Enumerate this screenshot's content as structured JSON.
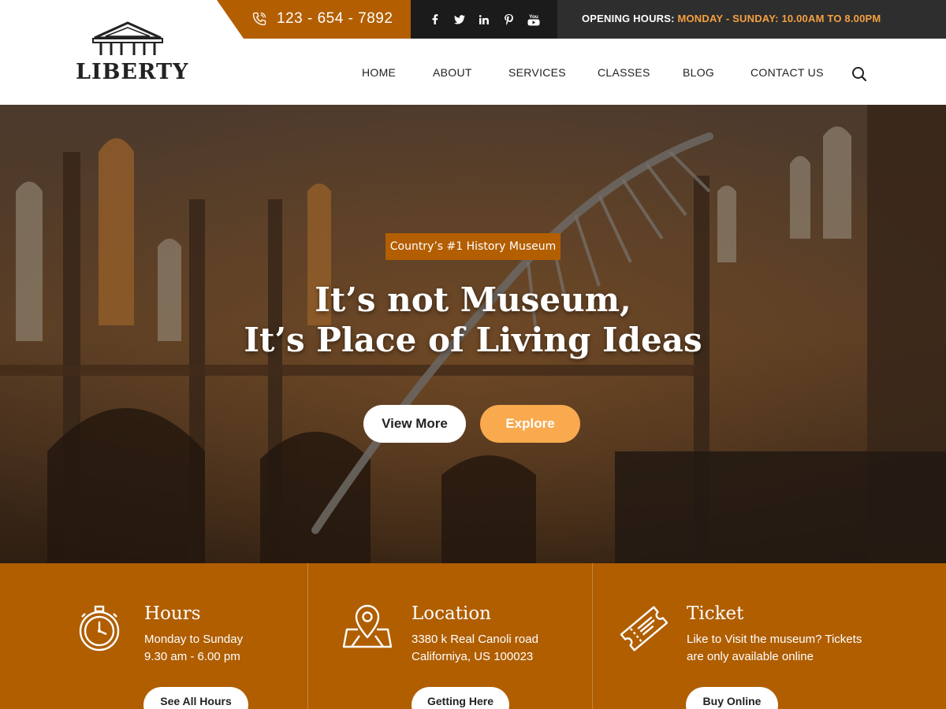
{
  "brand": {
    "name": "LIBERTY"
  },
  "topbar": {
    "phone": "123 - 654 - 7892",
    "social": [
      "facebook-icon",
      "twitter-icon",
      "linkedin-icon",
      "pinterest-icon",
      "youtube-icon"
    ],
    "youtube_text": "You",
    "hours_label": "OPENING HOURS:",
    "hours_value": "MONDAY - SUNDAY: 10.00AM TO 8.00PM"
  },
  "nav": {
    "items": [
      "HOME",
      "ABOUT",
      "SERVICES",
      "CLASSES",
      "BLOG",
      "CONTACT US"
    ]
  },
  "hero": {
    "badge": "Country’s #1 History Museum",
    "title_line1": "It’s not Museum,",
    "title_line2": "It’s Place of Living Ideas",
    "btn_view": "View More",
    "btn_explore": "Explore"
  },
  "info": [
    {
      "icon": "stopwatch-icon",
      "title": "Hours",
      "line1": "Monday to Sunday",
      "line2": "9.30 am - 6.00 pm",
      "button": "See All Hours"
    },
    {
      "icon": "map-pin-icon",
      "title": "Location",
      "line1": "3380 k Real Canoli road",
      "line2": "Californiya, US 100023",
      "button": "Getting Here"
    },
    {
      "icon": "ticket-icon",
      "title": "Ticket",
      "line1": "Like to Visit the museum? Tickets",
      "line2": "are only available online",
      "button": "Buy Online"
    }
  ],
  "colors": {
    "accent": "#b35e00",
    "accent_light": "#f9a94e",
    "hours_highlight": "#f5a040",
    "dark": "#1b1b1b"
  }
}
